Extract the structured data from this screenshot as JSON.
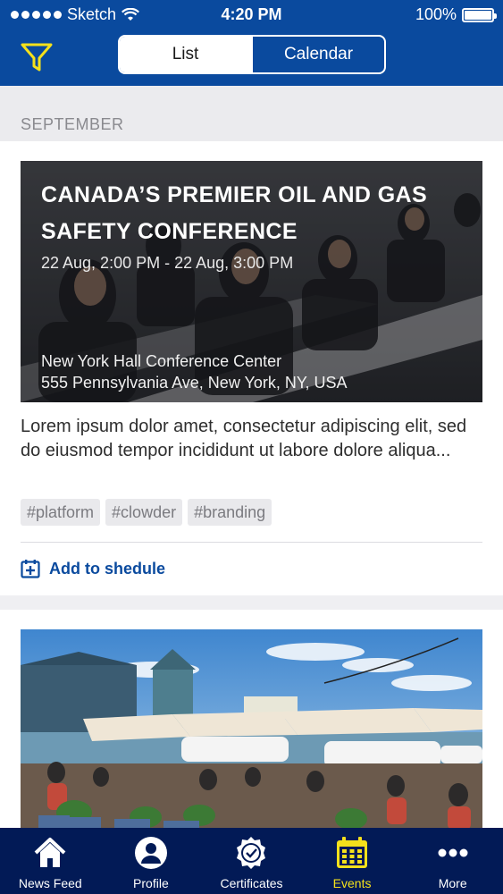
{
  "status_bar": {
    "carrier": "Sketch",
    "time": "4:20 PM",
    "battery": "100%"
  },
  "header": {
    "filter_icon": "filter-icon",
    "segments": [
      {
        "label": "List",
        "active": true
      },
      {
        "label": "Calendar",
        "active": false
      }
    ]
  },
  "month": "SEPTEMBER",
  "event": {
    "title": "CANADA’S PREMIER OIL AND GAS SAFETY CONFERENCE",
    "date": "22 Aug, 2:00 PM - 22 Aug, 3:00 PM",
    "venue_name": "New York Hall Conference Center",
    "venue_address": "555 Pennsylvania Ave, New York, NY, USA",
    "description": "Lorem ipsum dolor amet, consectetur adipiscing elit, sed do eiusmod tempor incididunt ut labore dolore  aliqua...",
    "tags": [
      "#platform",
      "#clowder",
      "#branding"
    ],
    "add_label": "Add to shedule"
  },
  "tabbar": {
    "items": [
      {
        "label": "News Feed",
        "icon": "home-icon"
      },
      {
        "label": "Profile",
        "icon": "profile-icon"
      },
      {
        "label": "Certificates",
        "icon": "certificate-icon"
      },
      {
        "label": "Events",
        "icon": "calendar-icon",
        "active": true
      },
      {
        "label": "More",
        "icon": "more-icon"
      }
    ]
  },
  "colors": {
    "brand": "#0a4a9e",
    "tabbar": "#021a56",
    "active_tab": "#f5e11b"
  }
}
